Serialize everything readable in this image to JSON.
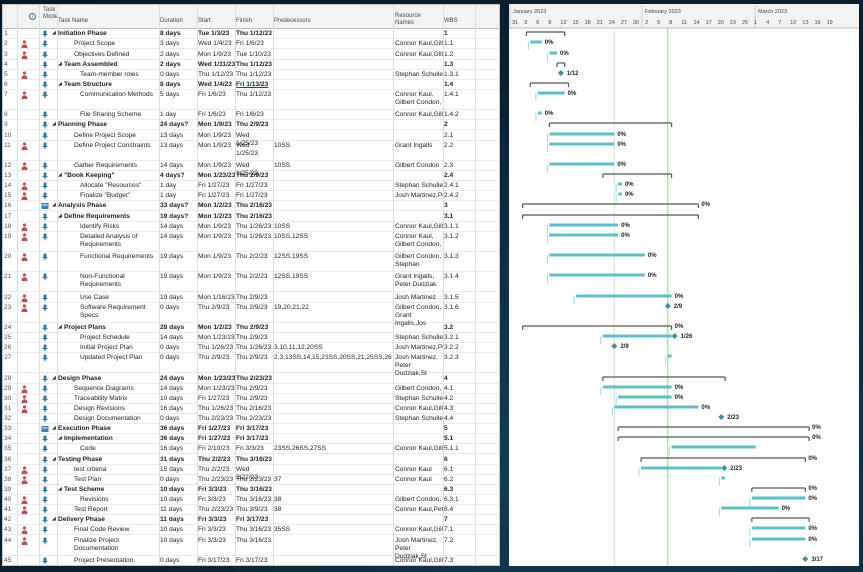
{
  "columns": {
    "info": "i",
    "mode": "Task Mode",
    "name": "Task Name",
    "duration": "Duration",
    "start": "Start",
    "finish": "Finish",
    "predecessors": "Predecessors",
    "resources": "Resource Names",
    "wbs": "WBS"
  },
  "tasks": [
    {
      "id": "1",
      "name": "Initiation Phase",
      "duration": "8 days",
      "start": "Tue 1/3/23",
      "finish": "Thu 1/12/23",
      "pred": "",
      "res": "",
      "wbs": "1",
      "level": 0,
      "summary": true,
      "person": false,
      "fs": "1/3/23",
      "ff": "1/12/23"
    },
    {
      "id": "2",
      "name": "Project Scope",
      "duration": "3 days",
      "start": "Wed 1/4/23",
      "finish": "Fri 1/6/23",
      "pred": "",
      "res": "Connor Kaul,Gill",
      "wbs": "1.1",
      "level": 2,
      "summary": false,
      "person": true,
      "pct": "0%"
    },
    {
      "id": "3",
      "name": "Objectives Defined",
      "duration": "2 days",
      "start": "Mon 1/9/23",
      "finish": "Tue 1/10/23",
      "pred": "",
      "res": "Connor Kaul,Gill",
      "wbs": "1.2",
      "level": 2,
      "summary": false,
      "person": true,
      "pct": "0%"
    },
    {
      "id": "4",
      "name": "Team Assembled",
      "duration": "2 days",
      "start": "Wed 1/11/23",
      "finish": "Thu 1/12/23",
      "pred": "",
      "res": "",
      "wbs": "1.3",
      "level": 1,
      "summary": true,
      "person": false
    },
    {
      "id": "5",
      "name": "Team-member roles",
      "duration": "0 days",
      "start": "Thu 1/12/23",
      "finish": "Thu 1/12/23",
      "pred": "",
      "res": "Stephan Schulle",
      "wbs": "1.3.1",
      "level": 3,
      "summary": false,
      "person": true,
      "milestone": "1/12"
    },
    {
      "id": "6",
      "name": "Team Structure",
      "duration": "8 days",
      "start": "Wed 1/4/23",
      "finish": "Fri 1/13/23",
      "pred": "",
      "res": "",
      "wbs": "1.4",
      "level": 1,
      "summary": true,
      "person": false
    },
    {
      "id": "7",
      "name": "Communication Methods",
      "duration": "5 days",
      "start": "Fri 1/6/23",
      "finish": "Thu 1/12/23",
      "pred": "",
      "res": "Connor Kaul, Gilbert Condon,",
      "wbs": "1.4.1",
      "level": 3,
      "summary": false,
      "person": true,
      "pct": "0%"
    },
    {
      "id": "8",
      "name": "File Sharing Scheme",
      "duration": "1 day",
      "start": "Fri 1/6/23",
      "finish": "Fri 1/6/23",
      "pred": "",
      "res": "Connor Kaul,Gill",
      "wbs": "1.4.2",
      "level": 3,
      "summary": false,
      "person": false,
      "pct": "0%"
    },
    {
      "id": "9",
      "name": "Planning Phase",
      "duration": "24 days?",
      "start": "Mon 1/9/23",
      "finish": "Thu 2/9/23",
      "pred": "",
      "res": "",
      "wbs": "2",
      "level": 0,
      "summary": true,
      "person": false
    },
    {
      "id": "10",
      "name": "Define Project Scope",
      "duration": "13 days",
      "start": "Mon 1/9/23",
      "finish": "Wed 1/25/23",
      "pred": "",
      "res": "",
      "wbs": "2.1",
      "level": 2,
      "summary": false,
      "person": false,
      "pct": "0%"
    },
    {
      "id": "11",
      "name": "Define Project Constraints",
      "duration": "13 days",
      "start": "Mon 1/9/23",
      "finish": "Wed 1/25/23",
      "pred": "10SS",
      "res": "Grant Ingalls",
      "wbs": "2.2",
      "level": 2,
      "summary": false,
      "person": true,
      "pct": "0%"
    },
    {
      "id": "12",
      "name": "Gather Requirements",
      "duration": "14 days",
      "start": "Mon 1/9/23",
      "finish": "Wed 1/25/23",
      "pred": "10SS",
      "res": "Gilbert Condon",
      "wbs": "2.3",
      "level": 2,
      "summary": false,
      "person": true,
      "pct": "0%"
    },
    {
      "id": "13",
      "name": "\"Book Keeping\"",
      "duration": "4 days?",
      "start": "Mon 1/23/23",
      "finish": "Thu 2/9/23",
      "pred": "",
      "res": "",
      "wbs": "2.4",
      "level": 1,
      "summary": true,
      "person": false
    },
    {
      "id": "14",
      "name": "Allocate \"Resources\"",
      "duration": "1 day",
      "start": "Fri 1/27/23",
      "finish": "Fri 1/27/23",
      "pred": "",
      "res": "Stephan Schulle",
      "wbs": "2.4.1",
      "level": 3,
      "summary": false,
      "person": true,
      "pct": "0%"
    },
    {
      "id": "15",
      "name": "Finalize \"Budget\"",
      "duration": "1 day",
      "start": "Fri 1/27/23",
      "finish": "Fri 1/27/23",
      "pred": "",
      "res": "Josh Martinez,Pe",
      "wbs": "2.4.2",
      "level": 3,
      "summary": false,
      "person": true,
      "pct": "0%"
    },
    {
      "id": "16",
      "name": "Analysis Phase",
      "duration": "33 days?",
      "start": "Mon 1/2/23",
      "finish": "Thu 2/16/23",
      "pred": "",
      "res": "",
      "wbs": "3",
      "level": 0,
      "summary": true,
      "person": false,
      "pct": "0%"
    },
    {
      "id": "17",
      "name": "Define Requirements",
      "duration": "19 days?",
      "start": "Mon 1/2/23",
      "finish": "Thu 2/16/23",
      "pred": "",
      "res": "",
      "wbs": "3.1",
      "level": 1,
      "summary": true,
      "person": false
    },
    {
      "id": "18",
      "name": "Identify Risks",
      "duration": "14 days",
      "start": "Mon 1/9/23",
      "finish": "Thu 1/26/23",
      "pred": "10SS",
      "res": "Connor Kaul,Gill",
      "wbs": "3.1.1",
      "level": 3,
      "summary": false,
      "person": true,
      "pct": "0%"
    },
    {
      "id": "19",
      "name": "Detailed Analysis of Requirements",
      "duration": "14 days",
      "start": "Mon 1/9/23",
      "finish": "Thu 1/26/23",
      "pred": "10SS,12SS",
      "res": "Connor Kaul, Gilbert Condon,",
      "wbs": "3.1.2",
      "level": 3,
      "summary": false,
      "person": true,
      "pct": "0%"
    },
    {
      "id": "20",
      "name": "Functional Requirements",
      "duration": "19 days",
      "start": "Mon 1/9/23",
      "finish": "Thu 2/2/23",
      "pred": "12SS,19SS",
      "res": "Gilbert Condon, Stephan",
      "wbs": "3.1.3",
      "level": 3,
      "summary": false,
      "person": true,
      "pct": "0%"
    },
    {
      "id": "21",
      "name": "Non-Functional Requirements",
      "duration": "19 days",
      "start": "Mon 1/9/23",
      "finish": "Thu 2/2/23",
      "pred": "12SS,19SS",
      "res": "Grant Ingalls, Peter Dudziak",
      "wbs": "3.1.4",
      "level": 3,
      "summary": false,
      "person": true,
      "pct": "0%"
    },
    {
      "id": "22",
      "name": "Use Case",
      "duration": "19 days",
      "start": "Mon 1/16/23",
      "finish": "Thu 2/9/23",
      "pred": "",
      "res": "Josh Martinez",
      "wbs": "3.1.5",
      "level": 3,
      "summary": false,
      "person": true,
      "pct": "0%"
    },
    {
      "id": "23",
      "name": "Software Requirement Specs",
      "duration": "0 days",
      "start": "Thu 2/9/23",
      "finish": "Thu 2/9/23",
      "pred": "19,20,21,22",
      "res": "Gilbert Condon, Grant Ingalls,Jos",
      "wbs": "3.1.6",
      "level": 3,
      "summary": false,
      "person": true,
      "milestone": "2/9"
    },
    {
      "id": "24",
      "name": "Project Plans",
      "duration": "28 days",
      "start": "Mon 1/2/23",
      "finish": "Thu 2/9/23",
      "pred": "",
      "res": "",
      "wbs": "3.2",
      "level": 1,
      "summary": true,
      "person": false,
      "pct": "0%"
    },
    {
      "id": "25",
      "name": "Project Schedule",
      "duration": "14 days",
      "start": "Mon 1/23/23",
      "finish": "Thu 2/9/23",
      "pred": "",
      "res": "Stephan Schulle",
      "wbs": "3.2.1",
      "level": 3,
      "summary": false,
      "person": false,
      "milestone": "1/26"
    },
    {
      "id": "26",
      "name": "Initial Project Plan",
      "duration": "0 days",
      "start": "Thu 1/26/23",
      "finish": "Thu 1/26/23",
      "pred": "3,10,11,12,20SS",
      "res": "Josh Martinez,Pe",
      "wbs": "3.2.2",
      "level": 3,
      "summary": false,
      "person": false,
      "milestone": "2/9"
    },
    {
      "id": "27",
      "name": "Updated Project Plan",
      "duration": "0 days",
      "start": "Thu 2/9/23",
      "finish": "Thu 2/9/23",
      "pred": "2,3,13SS,14,15,23SS,20SS,21,25SS,26",
      "res": "Josh Martinez, Peter Dudziak,St",
      "wbs": "3.2.3",
      "level": 3,
      "summary": false,
      "person": false
    },
    {
      "id": "28",
      "name": "Design Phase",
      "duration": "24 days",
      "start": "Mon 1/23/23",
      "finish": "Thu 2/23/23",
      "pred": "",
      "res": "",
      "wbs": "4",
      "level": 0,
      "summary": true,
      "person": false
    },
    {
      "id": "29",
      "name": "Sequence Diagrams",
      "duration": "14 days",
      "start": "Mon 1/23/23",
      "finish": "Thu 2/9/23",
      "pred": "",
      "res": "Gilbert Condon,",
      "wbs": "4.1",
      "level": 2,
      "summary": false,
      "person": true,
      "pct": "0%"
    },
    {
      "id": "30",
      "name": "Traceability Matrix",
      "duration": "10 days",
      "start": "Fri 1/27/23",
      "finish": "Thu 2/9/23",
      "pred": "",
      "res": "Stephan Schulle",
      "wbs": "4.2",
      "level": 2,
      "summary": false,
      "person": true,
      "pct": "0%"
    },
    {
      "id": "31",
      "name": "Design Revisions",
      "duration": "16 days",
      "start": "Thu 1/26/23",
      "finish": "Thu 2/16/23",
      "pred": "",
      "res": "Connor Kaul,Gill",
      "wbs": "4.3",
      "level": 2,
      "summary": false,
      "person": true,
      "pct": "0%"
    },
    {
      "id": "32",
      "name": "Design Documentation",
      "duration": "0 days",
      "start": "Thu 2/23/23",
      "finish": "Thu 2/23/23",
      "pred": "",
      "res": "Stephan Schulle",
      "wbs": "4.4",
      "level": 2,
      "summary": false,
      "person": false,
      "milestone": "2/23"
    },
    {
      "id": "33",
      "name": "Execution Phase",
      "duration": "36 days",
      "start": "Fri 1/27/23",
      "finish": "Fri 3/17/23",
      "pred": "",
      "res": "",
      "wbs": "5",
      "level": 0,
      "summary": true,
      "person": false,
      "pct": "0%"
    },
    {
      "id": "34",
      "name": "Implementation",
      "duration": "36 days",
      "start": "Fri 1/27/23",
      "finish": "Fri 3/17/23",
      "pred": "",
      "res": "",
      "wbs": "5.1",
      "level": 1,
      "summary": true,
      "person": false,
      "pct": "0%"
    },
    {
      "id": "35",
      "name": "Code",
      "duration": "16 days",
      "start": "Fri 2/10/23",
      "finish": "Fri 3/3/23",
      "pred": "23SS,26SS,27SS",
      "res": "Connor Kaul,Gill",
      "wbs": "5.1.1",
      "level": 3,
      "summary": false,
      "person": false
    },
    {
      "id": "36",
      "name": "Testing Phase",
      "duration": "31 days",
      "start": "Thu 2/2/23",
      "finish": "Thu 3/16/23",
      "pred": "",
      "res": "",
      "wbs": "6",
      "level": 0,
      "summary": true,
      "person": false,
      "pct": "0%"
    },
    {
      "id": "37",
      "name": "test criteria",
      "duration": "15 days",
      "start": "Thu 2/2/23",
      "finish": "Wed 2/22/23",
      "pred": "",
      "res": "Connor Kaul",
      "wbs": "6.1",
      "level": 2,
      "summary": false,
      "person": true,
      "milestone": "2/23"
    },
    {
      "id": "38",
      "name": "Test Plan",
      "duration": "0 days",
      "start": "Thu 2/23/23",
      "finish": "Thu 2/23/23",
      "pred": "37",
      "res": "Connor Kaul",
      "wbs": "6.2",
      "level": 2,
      "summary": false,
      "person": true
    },
    {
      "id": "39",
      "name": "Test Scheme",
      "duration": "10 days",
      "start": "Fri 3/3/23",
      "finish": "Thu 3/16/23",
      "pred": "",
      "res": "",
      "wbs": "6.3",
      "level": 1,
      "summary": true,
      "person": false,
      "pct": "0%"
    },
    {
      "id": "40",
      "name": "Revisions",
      "duration": "10 days",
      "start": "Fri 3/3/23",
      "finish": "Thu 3/16/23",
      "pred": "38",
      "res": "Gilbert Condon,",
      "wbs": "6.3.1",
      "level": 3,
      "summary": false,
      "person": true,
      "pct": "0%"
    },
    {
      "id": "41",
      "name": "Test Report",
      "duration": "11 days",
      "start": "Thu 2/23/23",
      "finish": "Thu 3/9/23",
      "pred": "38",
      "res": "Connor Kaul,Pet",
      "wbs": "6.4",
      "level": 2,
      "summary": false,
      "person": true,
      "pct": "0%"
    },
    {
      "id": "42",
      "name": "Delivery Phase",
      "duration": "11 days",
      "start": "Fri 3/3/23",
      "finish": "Fri 3/17/23",
      "pred": "",
      "res": "",
      "wbs": "7",
      "level": 0,
      "summary": true,
      "person": false
    },
    {
      "id": "43",
      "name": "Final Code Review",
      "duration": "10 days",
      "start": "Fri 3/3/23",
      "finish": "Thu 3/16/23",
      "pred": "35SS",
      "res": "Connor Kaul,Gill",
      "wbs": "7.1",
      "level": 2,
      "summary": false,
      "person": true,
      "pct": "0%"
    },
    {
      "id": "44",
      "name": "Finalize Project Documentation",
      "duration": "10 days",
      "start": "Fri 3/3/23",
      "finish": "Thu 3/16/23",
      "pred": "",
      "res": "Josh Martinez, Peter Dudziak,St",
      "wbs": "7.2",
      "level": 2,
      "summary": false,
      "person": true,
      "pct": "0%"
    },
    {
      "id": "45",
      "name": "Project Presentation",
      "duration": "0 days",
      "start": "Fri 3/17/23",
      "finish": "Fri 3/17/23",
      "pred": "",
      "res": "Connor Kaul,Gill",
      "wbs": "7.3",
      "level": 2,
      "summary": false,
      "person": false,
      "milestone": "3/17"
    }
  ],
  "gantt": {
    "months": [
      "January 2023",
      "February 2023",
      "March 2023"
    ],
    "days": [
      "31",
      "3",
      "6",
      "9",
      "12",
      "15",
      "18",
      "21",
      "24",
      "27",
      "30",
      "2",
      "5",
      "8",
      "11",
      "14",
      "17",
      "20",
      "23",
      "26",
      "1",
      "4",
      "7",
      "10",
      "13",
      "16",
      "19"
    ],
    "bar_color": "#5bc0c8",
    "summary_color": "#555555",
    "link_color": "#7fd3d9",
    "today_color": "#8fd48f"
  }
}
